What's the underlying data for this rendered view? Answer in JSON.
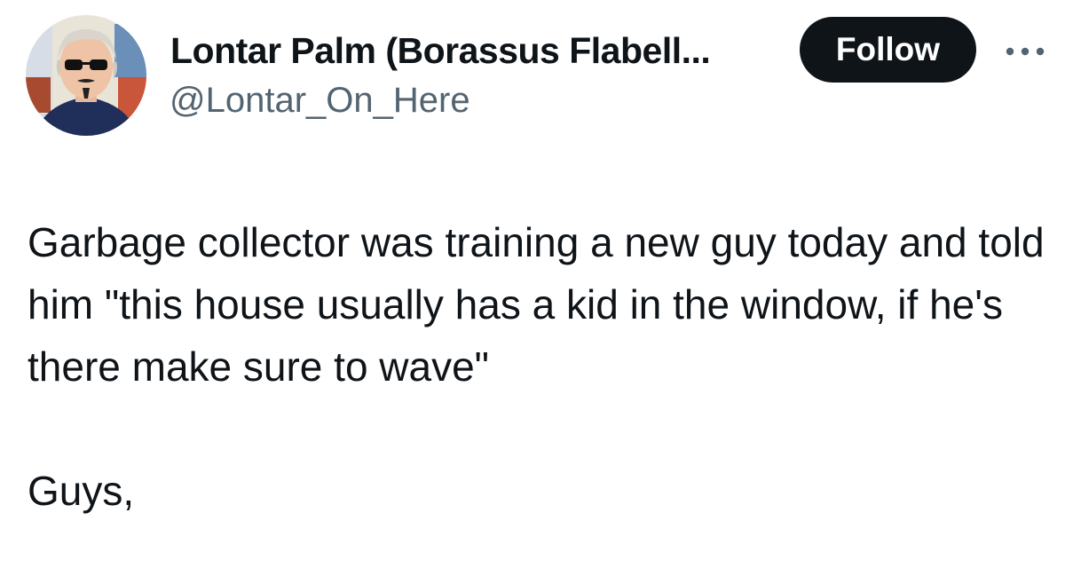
{
  "author": {
    "display_name": "Lontar Palm (Borassus Flabell...",
    "handle": "@Lontar_On_Here",
    "avatar_icon": "profile-photo"
  },
  "actions": {
    "follow_label": "Follow",
    "more_icon": "more-horizontal-icon"
  },
  "tweet": {
    "paragraph_1": "Garbage collector was training a new guy today and told him \"this house usually has a kid in the window, if he's there make sure to wave\"",
    "paragraph_2": "Guys,"
  },
  "colors": {
    "text": "#0f1419",
    "secondary_text": "#536471",
    "follow_bg": "#0f1419",
    "follow_text": "#ffffff",
    "background": "#ffffff"
  }
}
